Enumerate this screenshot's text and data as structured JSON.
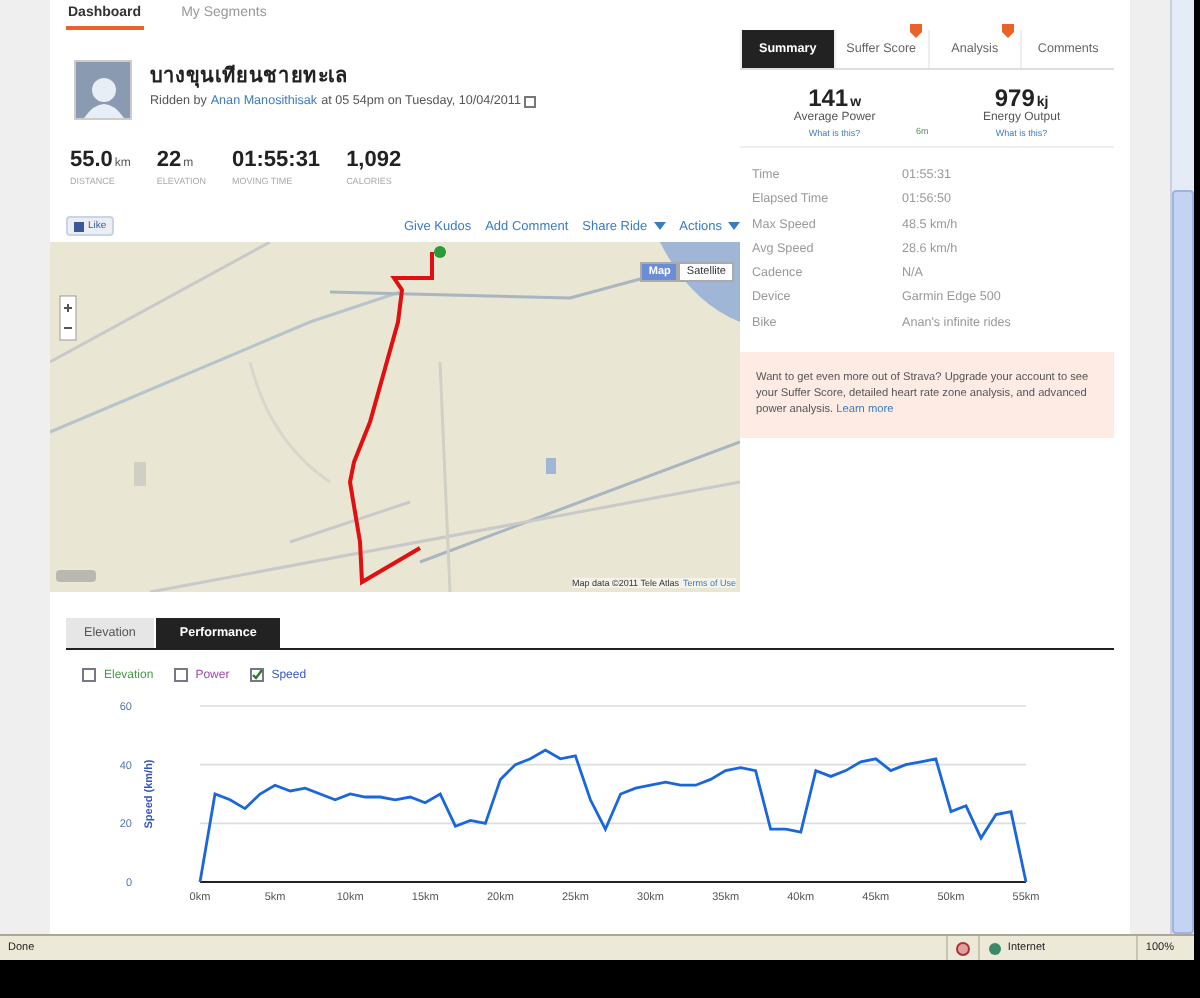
{
  "nav_tabs": [
    {
      "label": "Dashboard",
      "selected": true
    },
    {
      "label": "My Segments",
      "selected": false
    }
  ],
  "activity": {
    "title": "บางขุนเทียนชายทะเล",
    "ridden_by": "Ridden by",
    "athlete": "Anan Manosithisak",
    "when": "at 05 54pm on Tuesday, 10/04/2011"
  },
  "stats": [
    {
      "value": "55.0",
      "unit": "km",
      "label": "DISTANCE"
    },
    {
      "value": "22",
      "unit": "m",
      "label": "ELEVATION"
    },
    {
      "value": "01:55:31",
      "label": "MOVING TIME"
    },
    {
      "value": "1,092",
      "label": "CALORIES"
    }
  ],
  "like_button": "Like",
  "actions": [
    {
      "label": "Give Kudos",
      "dropdown": false
    },
    {
      "label": "Add Comment",
      "dropdown": false
    },
    {
      "label": "Share Ride",
      "dropdown": true
    },
    {
      "label": "Actions",
      "dropdown": true
    }
  ],
  "map": {
    "map_types": [
      {
        "label": "Map",
        "selected": true
      },
      {
        "label": "Satellite",
        "selected": false
      }
    ],
    "attribution": "Map data ©2011 Tele Atlas",
    "terms": "Terms of Use"
  },
  "side_tabs": [
    {
      "label": "Summary",
      "selected": true,
      "premium": false
    },
    {
      "label": "Suffer Score",
      "selected": false,
      "premium": true
    },
    {
      "label": "Analysis",
      "selected": false,
      "premium": true
    },
    {
      "label": "Comments",
      "selected": false,
      "premium": false
    }
  ],
  "metrics": [
    {
      "value": "141",
      "unit": "w",
      "label": "Average Power",
      "link": "What is this?"
    },
    {
      "value": "979",
      "unit": "kj",
      "label": "Energy Output",
      "link": "What is this?"
    }
  ],
  "metrics_note": "6m",
  "details": [
    {
      "label": "Time",
      "value": "01:55:31"
    },
    {
      "label": "Elapsed Time",
      "value": "01:56:50"
    },
    {
      "label": "Max Speed",
      "value": "48.5 km/h"
    },
    {
      "label": "Avg Speed",
      "value": "28.6 km/h"
    },
    {
      "label": "Cadence",
      "value": "N/A"
    },
    {
      "label": "Device",
      "value": "Garmin Edge 500"
    },
    {
      "label": "Bike",
      "value": "Anan's infinite rides"
    }
  ],
  "upgrade": {
    "text": "Want to get even more out of Strava? Upgrade your account to see your Suffer Score, detailed heart rate zone analysis, and advanced power analysis.",
    "link": "Learn more"
  },
  "chart_tabs": [
    {
      "label": "Elevation",
      "selected": false
    },
    {
      "label": "Performance",
      "selected": true
    }
  ],
  "series_toggles": [
    {
      "label": "Elevation",
      "checked": false,
      "color": "#4a9a4a"
    },
    {
      "label": "Power",
      "checked": false,
      "color": "#9a4aaa"
    },
    {
      "label": "Speed",
      "checked": true,
      "color": "#3355bb"
    }
  ],
  "chart_data": {
    "type": "line",
    "ylabel": "Speed (km/h)",
    "xlim": [
      0,
      55
    ],
    "ylim": [
      0,
      60
    ],
    "x": [
      0,
      1,
      2,
      3,
      4,
      5,
      6,
      7,
      8,
      9,
      10,
      11,
      12,
      13,
      14,
      15,
      16,
      17,
      18,
      19,
      20,
      21,
      22,
      23,
      24,
      25,
      26,
      27,
      28,
      29,
      30,
      31,
      32,
      33,
      34,
      35,
      36,
      37,
      38,
      39,
      40,
      41,
      42,
      43,
      44,
      45,
      46,
      47,
      48,
      49,
      50,
      51,
      52,
      53,
      54,
      55
    ],
    "series": [
      {
        "color": "#1a66dd",
        "values": [
          0,
          30,
          28,
          25,
          30,
          33,
          31,
          32,
          30,
          28,
          30,
          29,
          29,
          28,
          29,
          27,
          30,
          19,
          21,
          20,
          35,
          40,
          42,
          45,
          42,
          43,
          28,
          18,
          30,
          32,
          33,
          34,
          33,
          33,
          35,
          38,
          39,
          38,
          18,
          18,
          17,
          38,
          36,
          38,
          41,
          42,
          38,
          40,
          41,
          42,
          24,
          26,
          15,
          23,
          24,
          0
        ]
      }
    ],
    "xticks": [
      {
        "value": 0,
        "label": "0km"
      },
      {
        "value": 5,
        "label": "5km"
      },
      {
        "value": 10,
        "label": "10km"
      },
      {
        "value": 15,
        "label": "15km"
      },
      {
        "value": 20,
        "label": "20km"
      },
      {
        "value": 25,
        "label": "25km"
      },
      {
        "value": 30,
        "label": "30km"
      },
      {
        "value": 35,
        "label": "35km"
      },
      {
        "value": 40,
        "label": "40km"
      },
      {
        "value": 45,
        "label": "45km"
      },
      {
        "value": 50,
        "label": "50km"
      },
      {
        "value": 55,
        "label": "55km"
      }
    ],
    "yticks": [
      0,
      20,
      40,
      60
    ]
  },
  "status_bar": {
    "status": "Done",
    "zone": "Internet",
    "zoom": "100%"
  }
}
